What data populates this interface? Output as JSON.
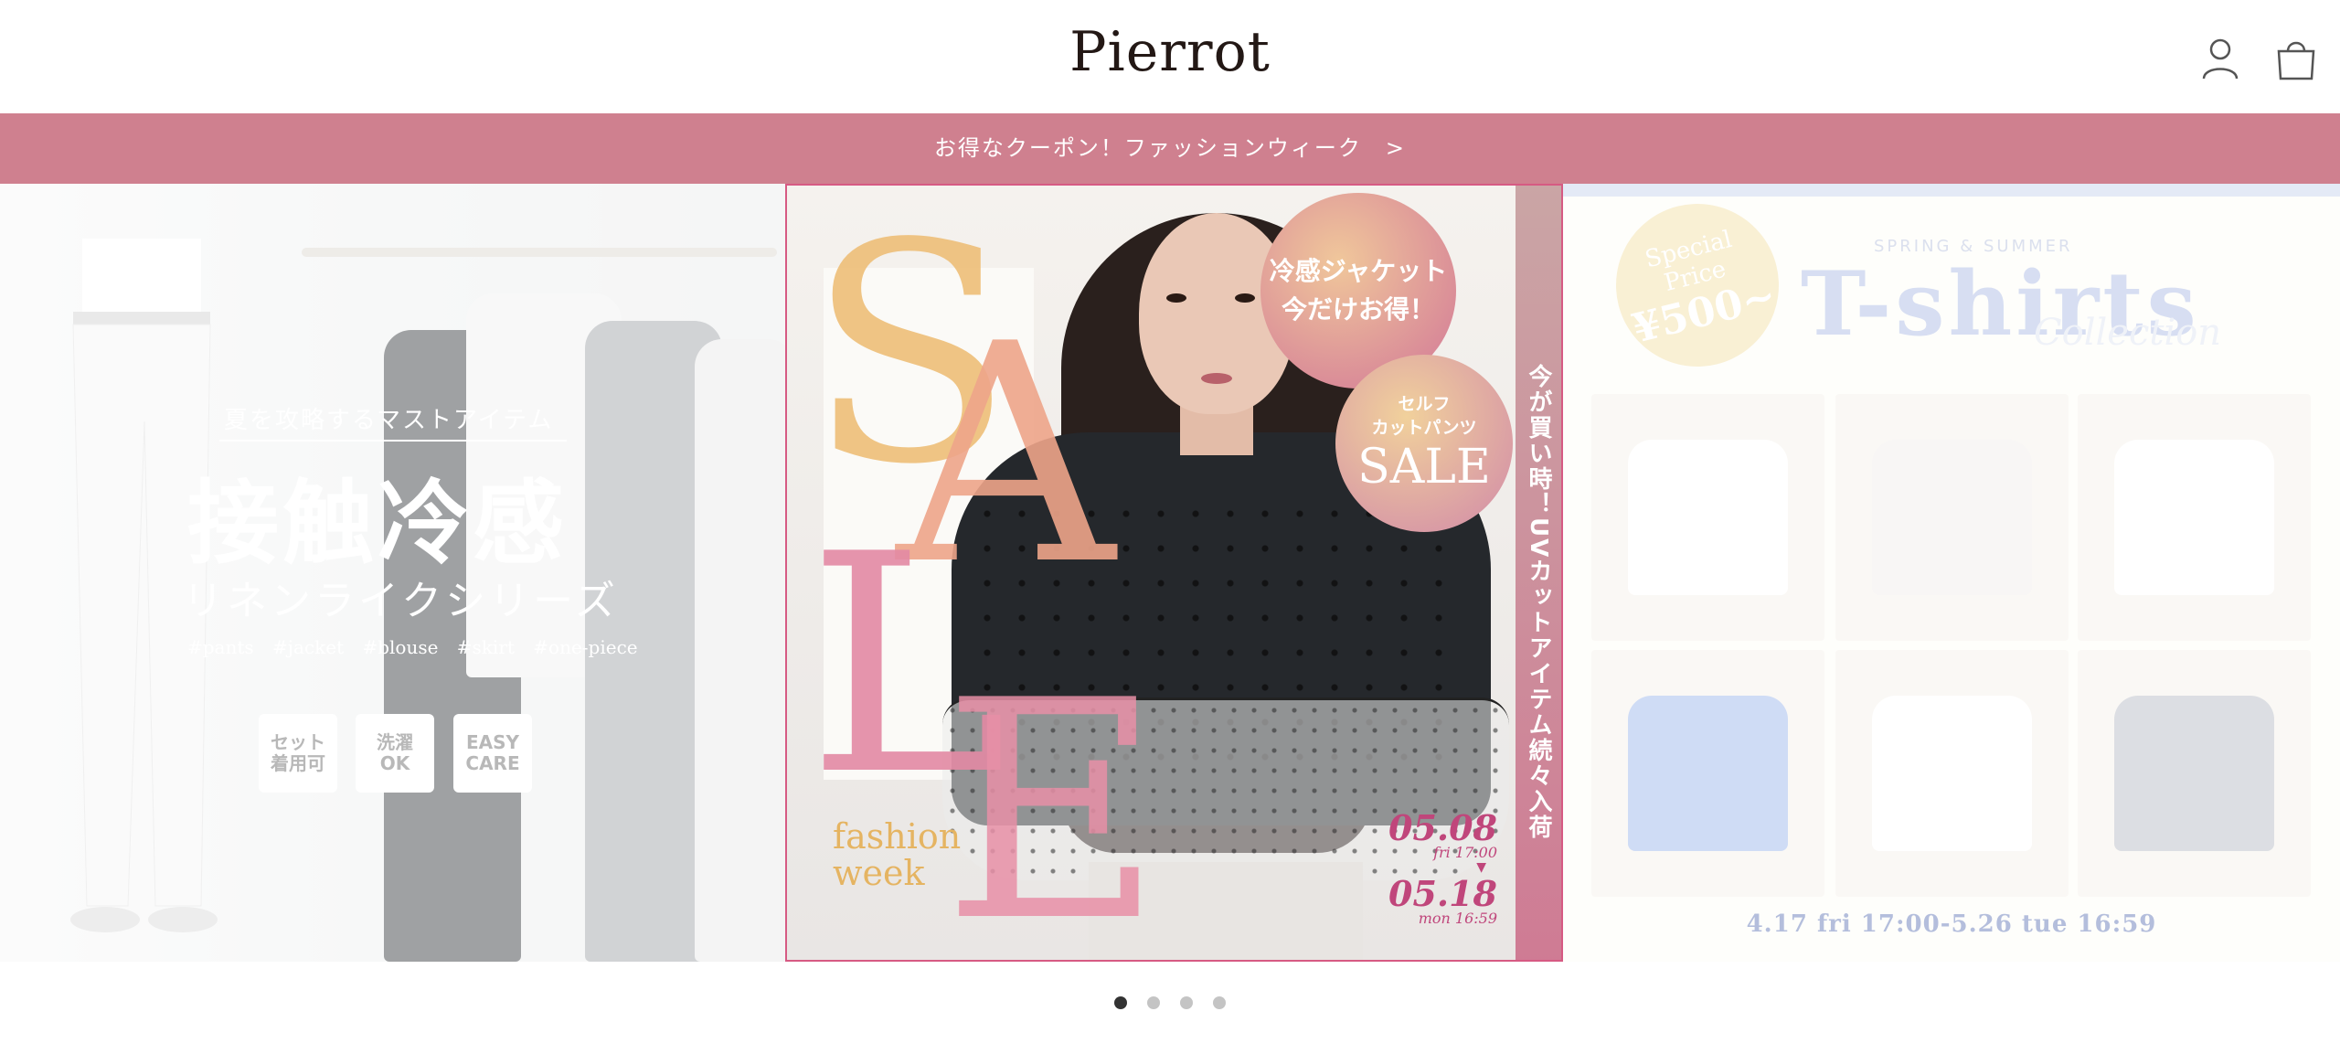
{
  "header": {
    "logo": "Pierrot"
  },
  "coupon_banner": {
    "label": "お得なクーポン！ファッションウィーク　>"
  },
  "slides": [
    {
      "id": "linen",
      "subtitle": "夏を攻略するマストアイテム",
      "title_line1": "接触冷感",
      "title_line2": "リネンライクシリーズ",
      "tags": "#pants #jacket #blouse #skirt #one-piece",
      "badges": [
        "セット\n着用可",
        "洗濯\nOK",
        "EASY\nCARE"
      ]
    },
    {
      "id": "sale",
      "big_text": [
        "S",
        "A",
        "L",
        "E"
      ],
      "subtitle": "fashion\nweek",
      "circle1": "冷感ジャケット\n今だけお得！",
      "circle2_small": "セルフ\nカットパンツ",
      "circle2_big": "SALE",
      "vertical": "今が買い時！UVカットアイテム続々入荷",
      "date_start": "05.08",
      "date_start_sub": "fri 17:00",
      "arrow": "▼",
      "date_end": "05.18",
      "date_end_sub": "mon 16:59"
    },
    {
      "id": "tshirts",
      "price_label_1": "Special",
      "price_label_2": "Price",
      "price": "¥500~",
      "season": "SPRING & SUMMER",
      "title": "T-shirts",
      "collection": "Collection",
      "period": "4.17 fri 17:00-5.26 tue 16:59"
    }
  ],
  "pagination": {
    "count": 4,
    "active": 1
  },
  "colors": {
    "coupon_bg": "#cf808f",
    "accent": "#d65a83"
  }
}
